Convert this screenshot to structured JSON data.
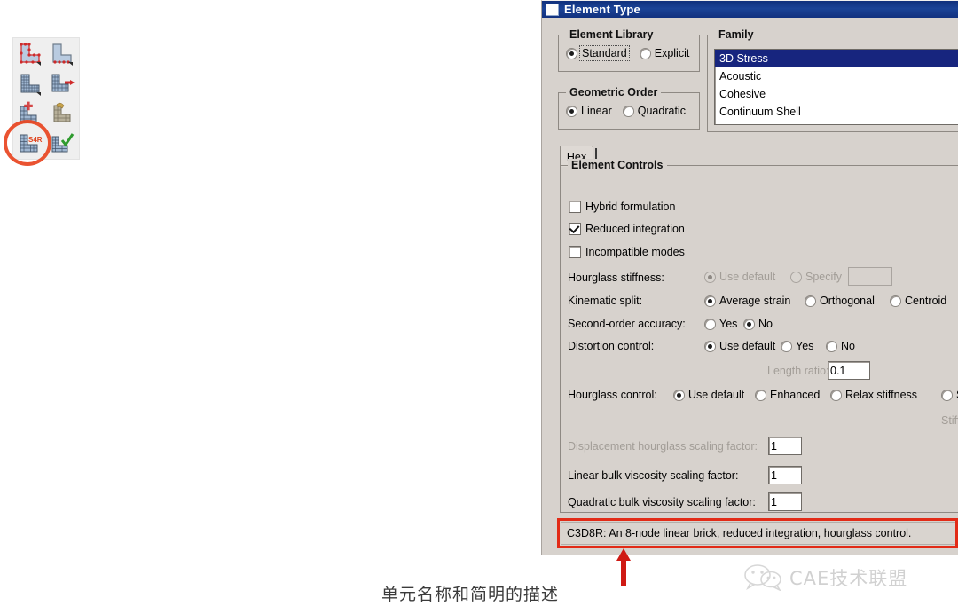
{
  "toolbar": {
    "name": "mesh-module-toolbar",
    "buttons": [
      {
        "id": "seed-part",
        "label": "Seed Part"
      },
      {
        "id": "seed-edges",
        "label": "Seed Edges"
      },
      {
        "id": "mesh-part",
        "label": "Mesh Part"
      },
      {
        "id": "mesh-region",
        "label": "Mesh Region"
      },
      {
        "id": "delete-mesh",
        "label": "Delete Part Native Mesh"
      },
      {
        "id": "mesh-controls",
        "label": "Assign Mesh Controls"
      },
      {
        "id": "element-type",
        "label": "Assign Element Type",
        "badge": "S4R",
        "highlighted": true
      },
      {
        "id": "verify-mesh",
        "label": "Verify Mesh"
      }
    ],
    "highlight_color": "#e8441f"
  },
  "dialog": {
    "title": "Element Type",
    "element_library": {
      "legend": "Element Library",
      "options": [
        {
          "label": "Standard",
          "selected": true,
          "focused": true
        },
        {
          "label": "Explicit",
          "selected": false,
          "focused": false
        }
      ]
    },
    "geometric_order": {
      "legend": "Geometric Order",
      "options": [
        {
          "label": "Linear",
          "selected": true
        },
        {
          "label": "Quadratic",
          "selected": false
        }
      ]
    },
    "family": {
      "legend": "Family",
      "items": [
        {
          "label": "3D Stress",
          "selected": true
        },
        {
          "label": "Acoustic",
          "selected": false
        },
        {
          "label": "Cohesive",
          "selected": false
        },
        {
          "label": "Continuum Shell",
          "selected": false
        }
      ],
      "selection_color": "#17257e"
    },
    "tabs": [
      {
        "label": "Hex",
        "active": true
      }
    ],
    "element_controls": {
      "legend": "Element Controls",
      "checkboxes": [
        {
          "label": "Hybrid formulation",
          "checked": false,
          "enabled": true
        },
        {
          "label": "Reduced integration",
          "checked": true,
          "enabled": true
        },
        {
          "label": "Incompatible modes",
          "checked": false,
          "enabled": true
        }
      ],
      "rows": [
        {
          "label": "Hourglass stiffness:",
          "label_enabled": true,
          "options": [
            {
              "label": "Use default",
              "selected": true,
              "enabled": false
            },
            {
              "label": "Specify",
              "selected": false,
              "enabled": false
            }
          ],
          "field": {
            "value": "",
            "enabled": false
          }
        },
        {
          "label": "Kinematic split:",
          "label_enabled": true,
          "options": [
            {
              "label": "Average strain",
              "selected": true,
              "enabled": true
            },
            {
              "label": "Orthogonal",
              "selected": false,
              "enabled": true
            },
            {
              "label": "Centroid",
              "selected": false,
              "enabled": true
            }
          ]
        },
        {
          "label": "Second-order accuracy:",
          "label_enabled": true,
          "options": [
            {
              "label": "Yes",
              "selected": false,
              "enabled": true
            },
            {
              "label": "No",
              "selected": true,
              "enabled": true
            }
          ]
        },
        {
          "label": "Distortion control:",
          "label_enabled": true,
          "options": [
            {
              "label": "Use default",
              "selected": true,
              "enabled": true
            },
            {
              "label": "Yes",
              "selected": false,
              "enabled": true
            },
            {
              "label": "No",
              "selected": false,
              "enabled": true
            }
          ]
        },
        {
          "label": "Hourglass control:",
          "label_enabled": true,
          "options": [
            {
              "label": "Use default",
              "selected": true,
              "enabled": true
            },
            {
              "label": "Enhanced",
              "selected": false,
              "enabled": true
            },
            {
              "label": "Relax stiffness",
              "selected": false,
              "enabled": true
            },
            {
              "label": "S",
              "selected": false,
              "enabled": true
            }
          ]
        }
      ],
      "length_ratio": {
        "label": "Length ratio:",
        "value": "0.1",
        "label_enabled": false
      },
      "stiffness_partial": "Stiffn",
      "factors": [
        {
          "label": "Displacement hourglass scaling factor:",
          "value": "1",
          "enabled": false
        },
        {
          "label": "Linear bulk viscosity scaling factor:",
          "value": "1",
          "enabled": true
        },
        {
          "label": "Quadratic bulk viscosity scaling factor:",
          "value": "1",
          "enabled": true
        }
      ]
    },
    "description": "C3D8R:  An 8-node linear brick, reduced integration, hourglass control.",
    "description_highlight_color": "#e22b17"
  },
  "annotation": {
    "caption": "单元名称和简明的描述",
    "arrow_color": "#cf1a14"
  },
  "watermark": {
    "text": "CAE技术联盟",
    "icon": "wechat-bubble-icon",
    "color": "#9a9a9a"
  }
}
